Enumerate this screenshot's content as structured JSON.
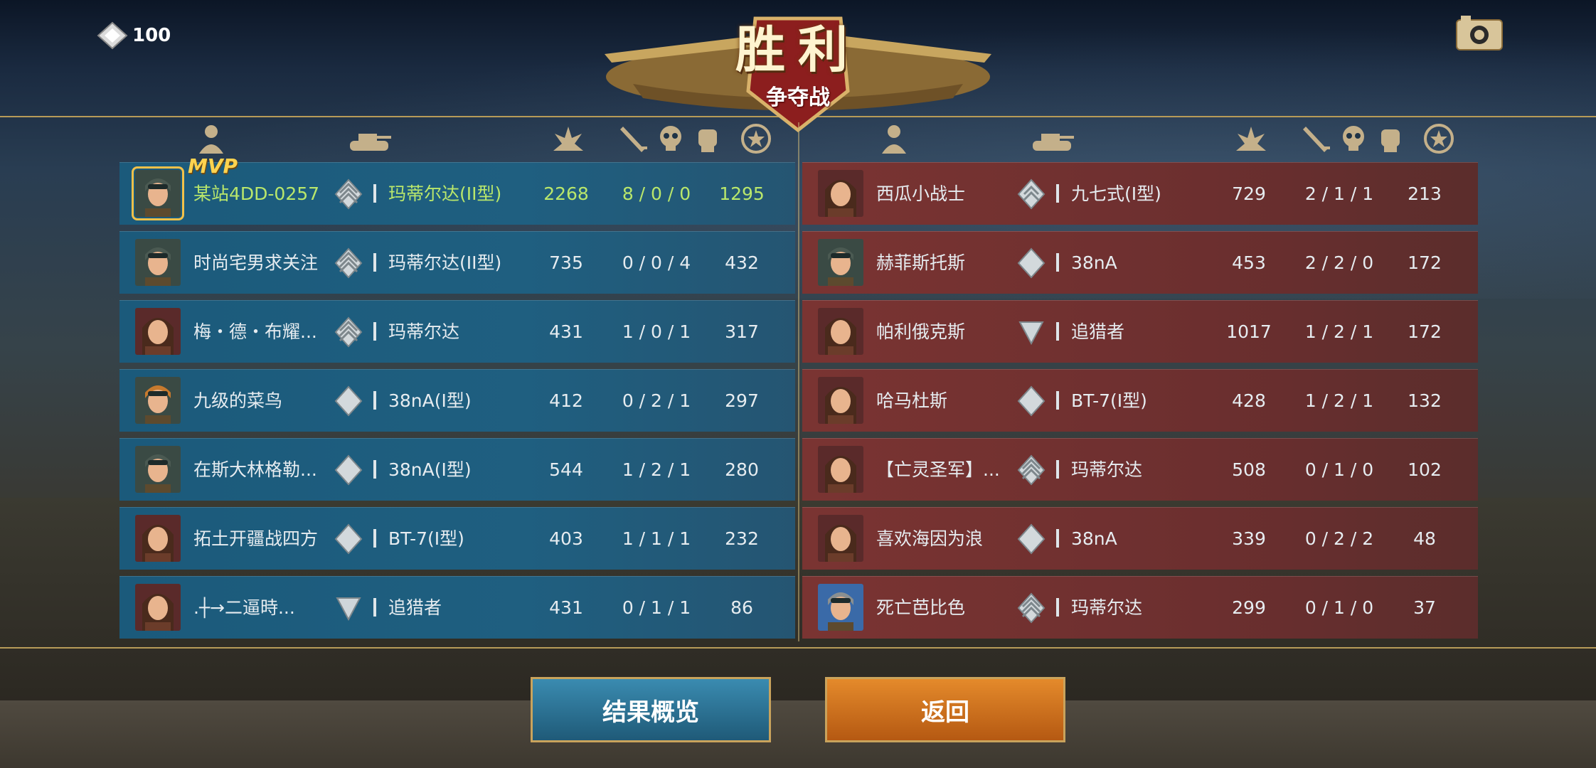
{
  "currency": {
    "icon": "diamond-currency-icon",
    "amount": "100"
  },
  "banner": {
    "title": "胜利",
    "subtitle": "争夺战"
  },
  "headers": [
    "player-icon",
    "tank-icon",
    "damage-icon",
    "kill-icon",
    "death-icon",
    "assist-icon",
    "score-icon"
  ],
  "blue_team": [
    {
      "name": "某站4DD-0257",
      "rank": "rank-3-icon",
      "tank": "玛蒂尔达(II型)",
      "damage": "2268",
      "kda": "8 / 0 / 0",
      "score": "1295",
      "mvp": true,
      "avatar": "pilot-male"
    },
    {
      "name": "时尚宅男求关注",
      "rank": "rank-3-icon",
      "tank": "玛蒂尔达(II型)",
      "damage": "735",
      "kda": "0 / 0 / 4",
      "score": "432",
      "avatar": "pilot-male"
    },
    {
      "name": "梅・德・布耀...",
      "rank": "rank-3-icon",
      "tank": "玛蒂尔达",
      "damage": "431",
      "kda": "1 / 0 / 1",
      "score": "317",
      "avatar": "female"
    },
    {
      "name": "九级的菜鸟",
      "rank": "rank-1-icon",
      "tank": "38nA(I型)",
      "damage": "412",
      "kda": "0 / 2 / 1",
      "score": "297",
      "avatar": "pilot-orange"
    },
    {
      "name": "在斯大林格勒...",
      "rank": "rank-1-icon",
      "tank": "38nA(I型)",
      "damage": "544",
      "kda": "1 / 2 / 1",
      "score": "280",
      "avatar": "pilot-male"
    },
    {
      "name": "拓土开疆战四方",
      "rank": "rank-1-icon",
      "tank": "BT-7(I型)",
      "damage": "403",
      "kda": "1 / 1 / 1",
      "score": "232",
      "avatar": "female"
    },
    {
      "name": ".┼→二逼時...",
      "rank": "rank-0-icon",
      "tank": "追猎者",
      "damage": "431",
      "kda": "0 / 1 / 1",
      "score": "86",
      "avatar": "female"
    }
  ],
  "red_team": [
    {
      "name": "西瓜小战士",
      "rank": "rank-2-icon",
      "tank": "九七式(I型)",
      "damage": "729",
      "kda": "2 / 1 / 1",
      "score": "213",
      "avatar": "female"
    },
    {
      "name": "赫菲斯托斯",
      "rank": "rank-1-icon",
      "tank": "38nA",
      "damage": "453",
      "kda": "2 / 2 / 0",
      "score": "172",
      "avatar": "pilot-male"
    },
    {
      "name": "帕利俄克斯",
      "rank": "rank-0-icon",
      "tank": "追猎者",
      "damage": "1017",
      "kda": "1 / 2 / 1",
      "score": "172",
      "avatar": "female"
    },
    {
      "name": "哈马杜斯",
      "rank": "rank-1-icon",
      "tank": "BT-7(I型)",
      "damage": "428",
      "kda": "1 / 2 / 1",
      "score": "132",
      "avatar": "female"
    },
    {
      "name": "【亡灵圣军】...",
      "rank": "rank-3-icon",
      "tank": "玛蒂尔达",
      "damage": "508",
      "kda": "0 / 1 / 0",
      "score": "102",
      "avatar": "female"
    },
    {
      "name": "喜欢海因为浪",
      "rank": "rank-1-icon",
      "tank": "38nA",
      "damage": "339",
      "kda": "0 / 2 / 2",
      "score": "48",
      "avatar": "female"
    },
    {
      "name": "死亡芭比色",
      "rank": "rank-3-icon",
      "tank": "玛蒂尔达",
      "damage": "299",
      "kda": "0 / 1 / 0",
      "score": "37",
      "avatar": "pilot-helmet"
    }
  ],
  "buttons": {
    "overview": "结果概览",
    "back": "返回"
  },
  "colors": {
    "blue_row": "#1f5f80",
    "red_row": "#6c2f2f",
    "highlight": "#b9e76b",
    "gold": "#b79b58",
    "button_blue": "#2c7396",
    "button_orange": "#d07420"
  }
}
